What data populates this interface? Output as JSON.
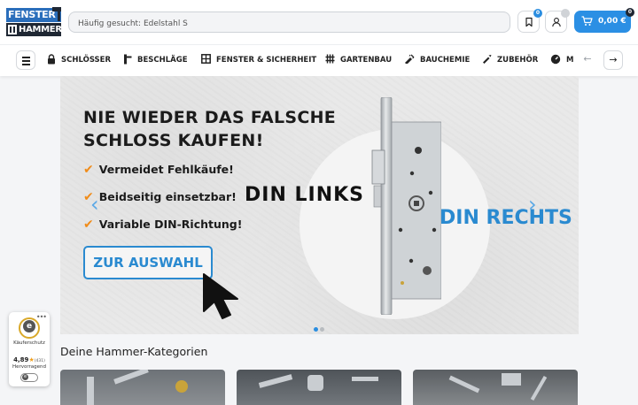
{
  "header": {
    "logo_top": "FENSTER",
    "logo_bottom": "HAMMER",
    "search_placeholder": "Häufig gesucht: Edelstahl S",
    "wishlist_count": "0",
    "cart_count": "0",
    "cart_total": "0,00 €"
  },
  "nav": {
    "items": [
      {
        "label": "SCHLÖSSER",
        "icon": "lock-icon"
      },
      {
        "label": "BESCHLÄGE",
        "icon": "door-handle-icon"
      },
      {
        "label": "FENSTER & SICHERHEIT",
        "icon": "window-icon"
      },
      {
        "label": "GARTENBAU",
        "icon": "fence-icon"
      },
      {
        "label": "BAUCHEMIE",
        "icon": "spray-icon"
      },
      {
        "label": "ZUBEHÖR",
        "icon": "tools-icon"
      },
      {
        "label": "M",
        "icon": "gauge-icon"
      }
    ],
    "prev_arrow": "←",
    "next_arrow": "→"
  },
  "hero": {
    "headline_line1": "NIE WIEDER DAS FALSCHE",
    "headline_line2": "SCHLOSS KAUFEN!",
    "bullets": [
      "Vermeidet Fehlkäufe!",
      "Beidseitig einsetzbar!",
      "Variable DIN-Richtung!"
    ],
    "cta": "ZUR AUSWAHL",
    "din_left": "DIN  LINKS",
    "din_right": "DIN RECHTS",
    "carousel_prev": "‹",
    "carousel_next": "›",
    "accent_color": "#2a8ad0"
  },
  "categories": {
    "title": "Deine Hammer-Kategorien"
  },
  "trust_badge": {
    "label": "Käuferschutz",
    "score": "4,89",
    "count": "(431)",
    "grade": "Hervorragend"
  }
}
